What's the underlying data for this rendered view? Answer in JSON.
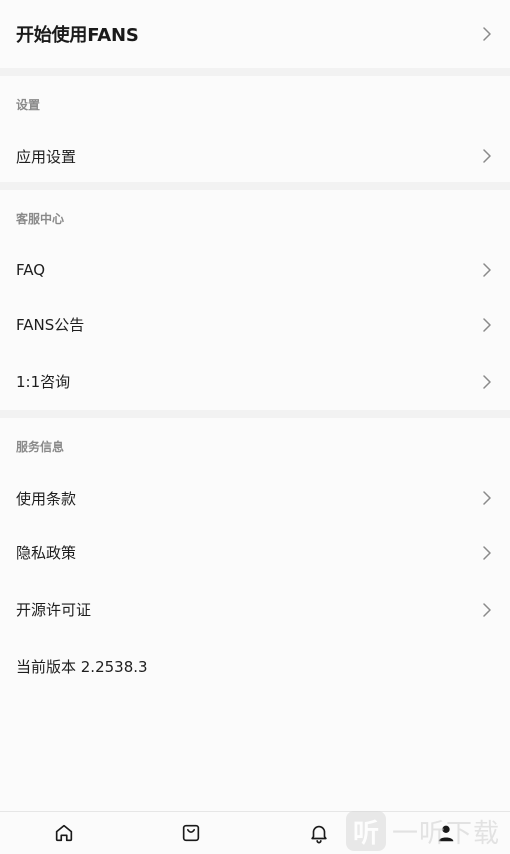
{
  "top": {
    "title": "开始使用FANS"
  },
  "sections": {
    "settings": {
      "header": "设置",
      "items": [
        "应用设置"
      ]
    },
    "support": {
      "header": "客服中心",
      "items": [
        "FAQ",
        "FANS公告",
        "1:1咨询"
      ]
    },
    "service": {
      "header": "服务信息",
      "items": [
        "使用条款",
        "隐私政策",
        "开源许可证"
      ],
      "version": "当前版本 2.2538.3"
    }
  },
  "tabbar": {
    "icons": [
      "home-icon",
      "shopping-bag-icon",
      "bell-icon",
      "profile-icon"
    ]
  },
  "watermark": {
    "glyph": "听",
    "text": "一听下载"
  }
}
